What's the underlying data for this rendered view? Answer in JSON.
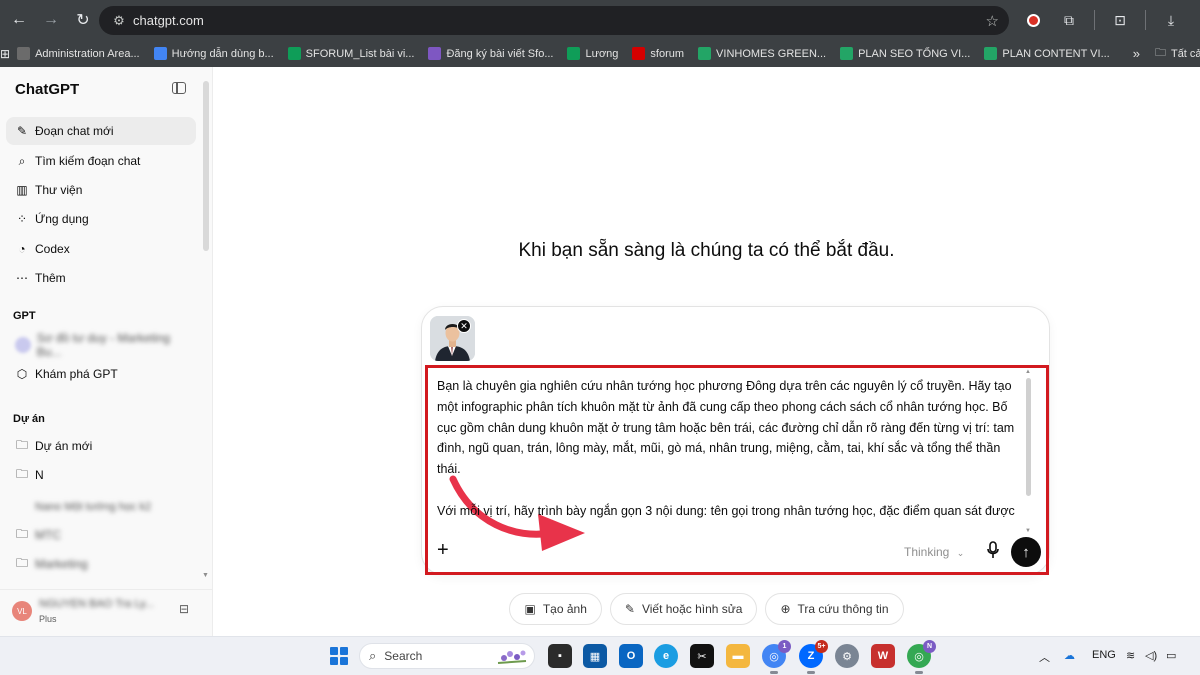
{
  "browser": {
    "url": "chatgpt.com",
    "bookmarks": [
      {
        "label": "Administration Area...",
        "color": "#6b6b6b"
      },
      {
        "label": "Hướng dẫn dùng b...",
        "color": "#4285f4"
      },
      {
        "label": "SFORUM_List bài vi...",
        "color": "#0f9d58"
      },
      {
        "label": "Đăng ký bài viết Sfo...",
        "color": "#7e57c2"
      },
      {
        "label": "Lương",
        "color": "#0f9d58"
      },
      {
        "label": "sforum",
        "color": "#d50000"
      },
      {
        "label": "VINHOMES GREEN...",
        "color": "#23a566"
      },
      {
        "label": "PLAN SEO TỔNG VI...",
        "color": "#23a566"
      },
      {
        "label": "PLAN CONTENT VI...",
        "color": "#23a566"
      }
    ],
    "bookmarks_more": "»",
    "all_bookmarks": "Tất cả"
  },
  "sidebar": {
    "brand": "ChatGPT",
    "items": [
      {
        "label": "Đoạn chat mới",
        "icon": "✎"
      },
      {
        "label": "Tìm kiếm đoạn chat",
        "icon": "⌕"
      },
      {
        "label": "Thư viện",
        "icon": "▥"
      },
      {
        "label": "Ứng dụng",
        "icon": "⁘"
      },
      {
        "label": "Codex",
        "icon": "◔"
      },
      {
        "label": "Thêm",
        "icon": "⋯"
      }
    ],
    "gpt_header": "GPT",
    "gpt_blurred": "Sơ đồ tư duy - Marketing Bu...",
    "explore_gpt": "Khám phá GPT",
    "projects_header": "Dự án",
    "new_project": "Dự án mới",
    "project_n": "N",
    "project_blurred": "Nano Một tướng học k2",
    "project_m": "MTC",
    "project_marketing": "Marketing",
    "user_initials": "VL",
    "user_name": "NGUYEN BAO Tra Ly...",
    "user_plan": "Plus"
  },
  "main": {
    "hero": "Khi bạn sẵn sàng là chúng ta có thể bắt đầu.",
    "prompt": "Bạn là chuyên gia nghiên cứu nhân tướng học phương Đông dựa trên các nguyên lý cổ truyền. Hãy tạo một infographic phân tích khuôn mặt từ ảnh đã cung cấp theo phong cách sách cổ nhân tướng học. Bố cục gồm chân dung khuôn mặt ở trung tâm hoặc bên trái, các đường chỉ dẫn rõ ràng đến từng vị trí: tam đình, ngũ quan, trán, lông mày, mắt, mũi, gò má, nhân trung, miệng, cằm, tai, khí sắc và tổng thể thần thái.\n\nVới mỗi vị trí, hãy trình bày ngắn gọn 3 nội dung: tên gọi trong nhân tướng học, đặc điểm quan sát được và ý nghĩa tham khảo về tính cách, tư duy, tài vận, nhân duyên hoặc hậu vận. Thiết kế",
    "thinking": "Thinking",
    "chips": [
      {
        "label": "Tạo ảnh",
        "icon": "image-icon"
      },
      {
        "label": "Viết hoặc hình sửa",
        "icon": "pen-icon"
      },
      {
        "label": "Tra cứu thông tin",
        "icon": "globe-icon"
      }
    ],
    "highlight_color": "#d2191f",
    "arrow_color": "#e8334a"
  },
  "taskbar": {
    "search": "Search",
    "lang": "ENG",
    "badges": {
      "chrome": "1",
      "zalo": "5+",
      "chrome2": "N"
    }
  }
}
